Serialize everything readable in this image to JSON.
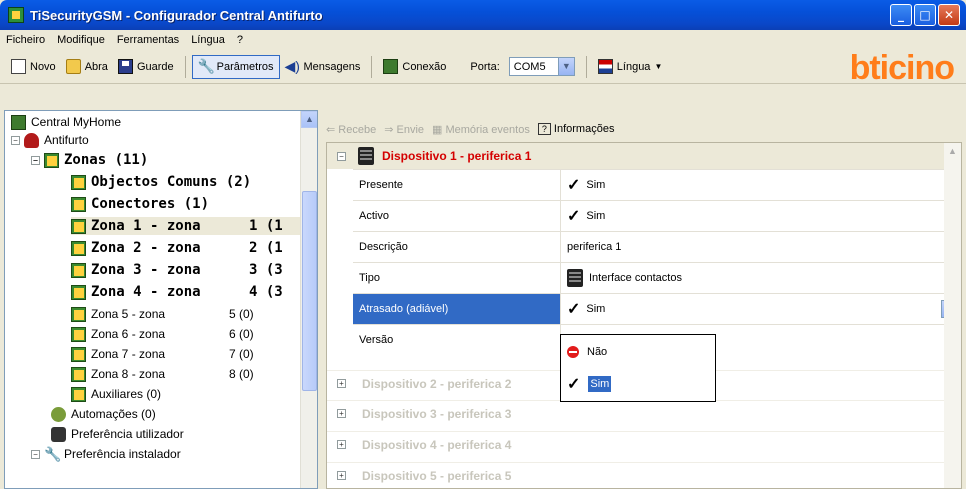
{
  "window": {
    "title": "TiSecurityGSM - Configurador Central Antifurto",
    "buttons": {
      "minimize": "_",
      "maximize": "□",
      "close": "✕"
    }
  },
  "menu": [
    "Ficheiro",
    "Modifique",
    "Ferramentas",
    "Língua",
    "?"
  ],
  "toolbar": {
    "novo": "Novo",
    "abra": "Abra",
    "guarde": "Guarde",
    "parametros": "Parâmetros",
    "mensagens": "Mensagens",
    "conexao": "Conexão",
    "porta_label": "Porta:",
    "porta_value": "COM5",
    "lingua": "Língua"
  },
  "brand": "bticino",
  "tree": {
    "root": "Central MyHome",
    "antifurto": "Antifurto",
    "zonas": "Zonas (11)",
    "objectos": "Objectos Comuns (2)",
    "conectores": "Conectores (1)",
    "zones": [
      {
        "name": "Zona 1 - zona",
        "count": "1 (1"
      },
      {
        "name": "Zona 2 - zona",
        "count": "2 (1"
      },
      {
        "name": "Zona 3 - zona",
        "count": "3 (3"
      },
      {
        "name": "Zona 4 - zona",
        "count": "4 (3"
      },
      {
        "name": "Zona 5 - zona",
        "count": "5 (0)"
      },
      {
        "name": "Zona 6 - zona",
        "count": "6 (0)"
      },
      {
        "name": "Zona 7 - zona",
        "count": "7 (0)"
      },
      {
        "name": "Zona 8 - zona",
        "count": "8 (0)"
      }
    ],
    "auxiliares": "Auxiliares (0)",
    "automacoes": "Automações (0)",
    "pref_utilizador": "Preferência utilizador",
    "pref_instalador": "Preferência instalador"
  },
  "right_toolbar": {
    "recebe": "Recebe",
    "envie": "Envie",
    "memoria": "Memória eventos",
    "informacoes": "Informações"
  },
  "device": {
    "title": "Dispositivo 1 - periferica 1",
    "rows": [
      {
        "name": "Presente",
        "value": "Sim"
      },
      {
        "name": "Activo",
        "value": "Sim"
      },
      {
        "name": "Descrição",
        "value": "periferica 1"
      },
      {
        "name": "Tipo",
        "value": "Interface contactos"
      },
      {
        "name": "Atrasado (adiável)",
        "value": "Sim"
      },
      {
        "name": "Versão",
        "value": ""
      }
    ],
    "dropdown_options": [
      "Não",
      "Sim"
    ]
  },
  "collapsed_devices": [
    "Dispositivo 2 - periferica 2",
    "Dispositivo 3 - periferica 3",
    "Dispositivo 4 - periferica 4",
    "Dispositivo 5 - periferica 5"
  ]
}
